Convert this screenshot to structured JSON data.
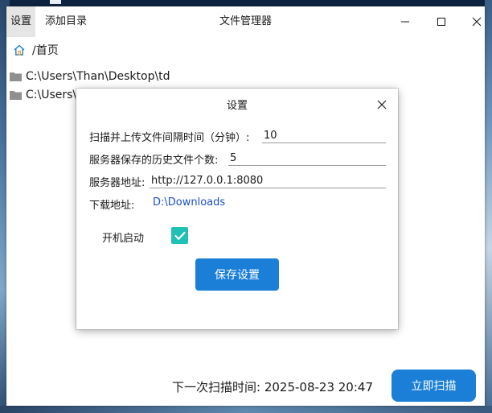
{
  "window": {
    "title": "文件管理器",
    "menu": {
      "settings": "设置",
      "add_dir": "添加目录"
    }
  },
  "breadcrumb": {
    "path": "/首页"
  },
  "files": [
    {
      "path": "C:\\Users\\Than\\Desktop\\td"
    },
    {
      "path": "C:\\Users\\"
    }
  ],
  "status": {
    "next_scan": "下一次扫描时间: 2025-08-23 20:47"
  },
  "scan_button": "立即扫描",
  "dialog": {
    "title": "设置",
    "interval_label": "扫描并上传文件间隔时间（分钟）:",
    "interval_value": "10",
    "history_label": "服务器保存的历史文件个数:",
    "history_value": "5",
    "server_label": "服务器地址:",
    "server_value": "http://127.0.0.1:8080",
    "download_label": "下载地址:",
    "download_value": "D:\\Downloads",
    "autostart_label": "开机启动",
    "autostart_checked": true,
    "save_button": "保存设置"
  },
  "colors": {
    "accent": "#1b7fd8",
    "checkbox": "#1fc0b5",
    "link": "#1a4fd1"
  }
}
